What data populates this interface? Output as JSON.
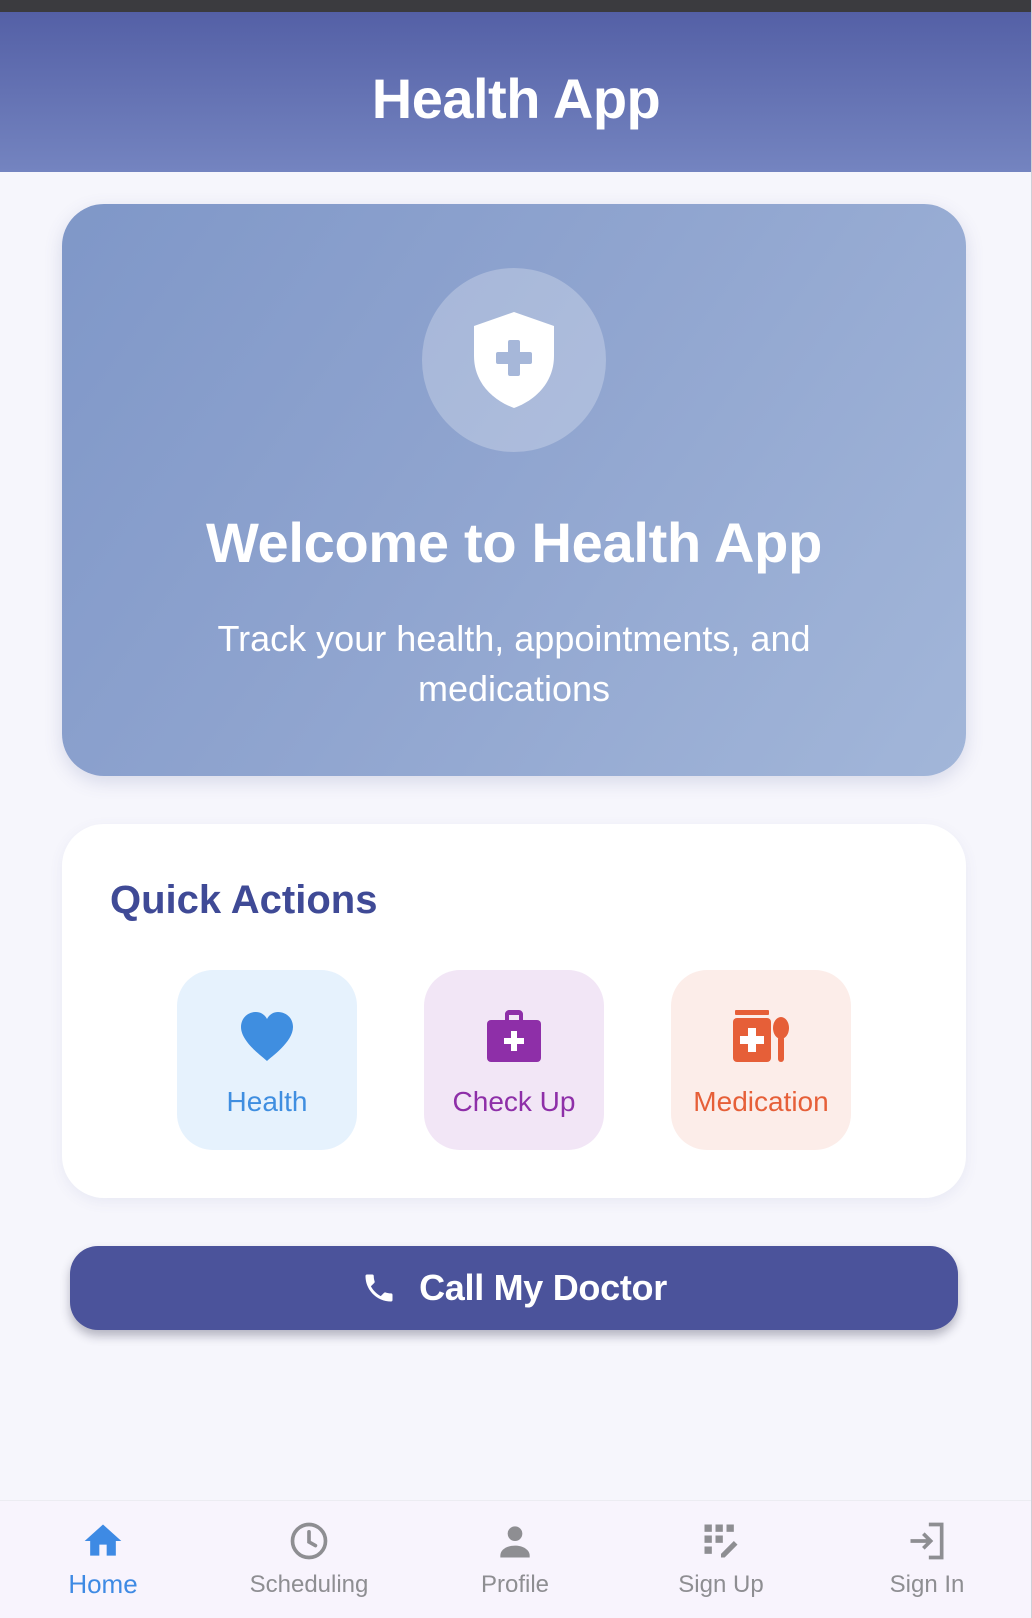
{
  "app_bar": {
    "title": "Health App"
  },
  "welcome": {
    "icon": "shield-plus-icon",
    "title": "Welcome to Health App",
    "subtitle": "Track your health, appointments, and medications"
  },
  "quick_actions": {
    "title": "Quick Actions",
    "items": [
      {
        "label": "Health",
        "icon": "heart-icon",
        "color": "#3f8ee0",
        "bg": "#e6f2fd"
      },
      {
        "label": "Check Up",
        "icon": "medical-kit-icon",
        "color": "#8e2fa8",
        "bg": "#f2e6f6"
      },
      {
        "label": "Medication",
        "icon": "medication-icon",
        "color": "#e65f38",
        "bg": "#fcede9"
      }
    ]
  },
  "call_button": {
    "label": "Call My Doctor",
    "icon": "phone-icon",
    "color": "#4b539b"
  },
  "bottom_nav": {
    "active": "Home",
    "items": [
      {
        "label": "Home",
        "icon": "home-icon"
      },
      {
        "label": "Scheduling",
        "icon": "clock-icon"
      },
      {
        "label": "Profile",
        "icon": "person-icon"
      },
      {
        "label": "Sign Up",
        "icon": "app-registration-icon"
      },
      {
        "label": "Sign In",
        "icon": "login-icon"
      }
    ]
  },
  "colors": {
    "primary": "#4b539b",
    "header_start": "#5460a6",
    "header_end": "#7484c0",
    "accent_active": "#3e8ae4"
  }
}
